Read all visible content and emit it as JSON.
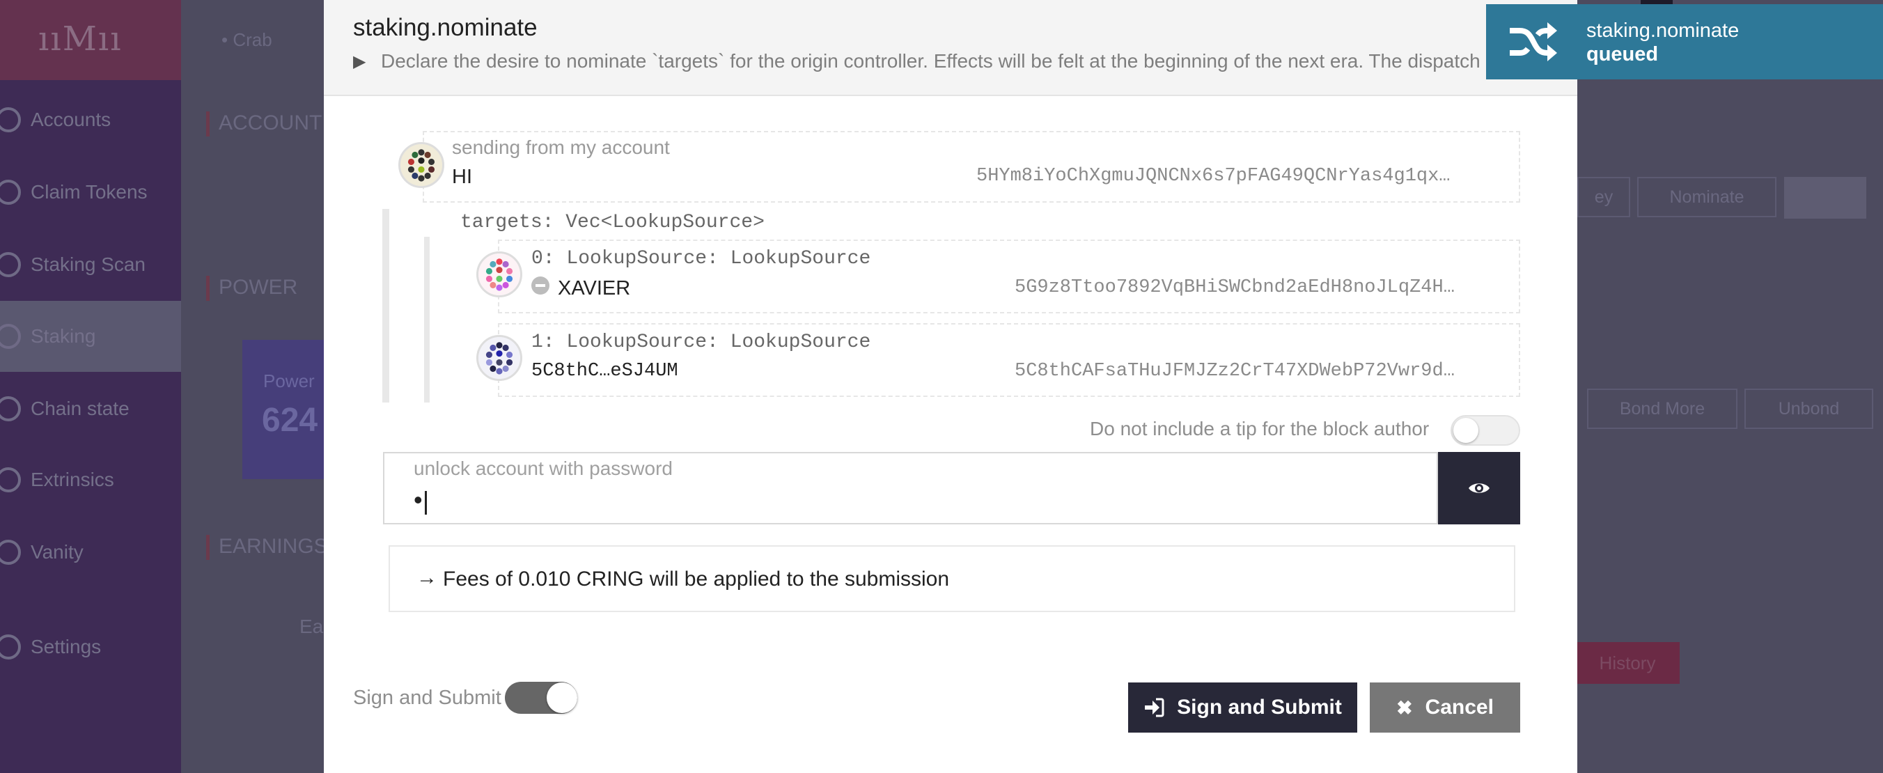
{
  "background": {
    "logo": "ııМıı",
    "sidebar": [
      {
        "label": "Accounts",
        "icon": "users-icon"
      },
      {
        "label": "Claim Tokens",
        "icon": "star-icon"
      },
      {
        "label": "Staking Scan",
        "icon": "eye-icon"
      },
      {
        "label": "Staking",
        "icon": "stack-icon",
        "active": true
      },
      {
        "label": "Chain state",
        "icon": "database-icon"
      },
      {
        "label": "Extrinsics",
        "icon": "redo-icon"
      },
      {
        "label": "Vanity",
        "icon": "users-icon"
      },
      {
        "label": "Settings",
        "icon": "gears-icon"
      }
    ],
    "crab": "Crab",
    "sections": [
      "ACCOUNT",
      "POWER",
      "EARNINGS"
    ],
    "power_box": {
      "label": "Power",
      "value": "624"
    },
    "earnings_label": "Ea",
    "buttons": {
      "key": "ey",
      "nominate": "Nominate",
      "bond_more": "Bond More",
      "unbond": "Unbond",
      "history": "History"
    }
  },
  "modal": {
    "title": "staking.nominate",
    "doc_toggle": "▶",
    "documentation": "Declare the desire to nominate `targets` for the origin controller. Effects will be felt at the beginning of the next era. The dispatch origin for this call must be _Signed_ by the controller, not the stash.",
    "sender": {
      "label": "sending from my account",
      "name": "HI",
      "address": "5HYm8iYoChXgmuJQNCNx6s7pFAG49QCNrYas4g1qx…"
    },
    "targets_label": "targets: Vec<LookupSource>",
    "targets": [
      {
        "label": "0: LookupSource: LookupSource",
        "name": "XAVIER",
        "address": "5G9z8Ttoo7892VqBHiSWCbnd2aEdH8noJLqZ4H…"
      },
      {
        "label": "1: LookupSource: LookupSource",
        "name": "5C8thC…eSJ4UM",
        "address": "5C8thCAFsaTHuJFMJZz2CrT47XDWebP72Vwr9d…"
      }
    ],
    "tip_label": "Do not include a tip for the block author",
    "tip_enabled": false,
    "password": {
      "label": "unlock account with password",
      "value": "•"
    },
    "fees_arrow": "→",
    "fees_text": "Fees of 0.010 CRING will be applied to the submission",
    "sign_and_submit_toggle_label": "Sign and Submit",
    "sign_and_submit_enabled": true,
    "submit_label": "Sign and Submit",
    "cancel_label": "Cancel",
    "cancel_icon": "✖"
  },
  "toast": {
    "title": "staking.nominate",
    "status": "queued",
    "icon": "shuffle-icon"
  },
  "colors": {
    "dark_button": "#282838",
    "cancel_button": "#777777",
    "toast": "#2e7898",
    "sidebar": "#3e2b55"
  }
}
